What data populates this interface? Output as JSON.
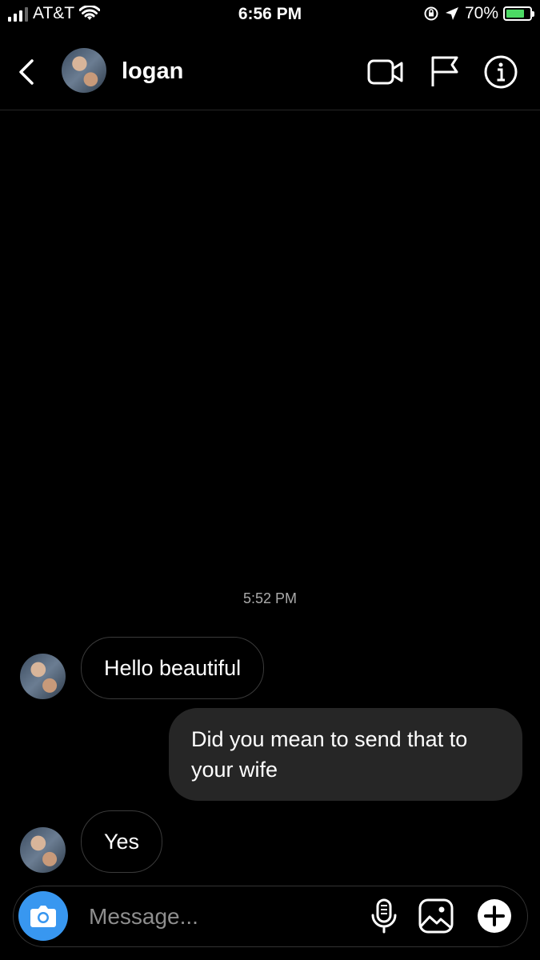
{
  "status_bar": {
    "carrier": "AT&T",
    "time": "6:56 PM",
    "battery_percent": "70%",
    "battery_level": 0.7,
    "battery_color": "#4cd964"
  },
  "header": {
    "back_icon": "chevron-left-icon",
    "username": "logan",
    "video_icon": "video-camera-icon",
    "flag_icon": "flag-icon",
    "info_icon": "info-icon"
  },
  "chat": {
    "timestamp": "5:52 PM",
    "messages": [
      {
        "direction": "incoming",
        "text": "Hello beautiful"
      },
      {
        "direction": "outgoing",
        "text": "Did you mean to send that to your wife"
      },
      {
        "direction": "incoming",
        "text": "Yes"
      }
    ]
  },
  "composer": {
    "placeholder": "Message...",
    "camera_icon": "camera-icon",
    "mic_icon": "microphone-icon",
    "gallery_icon": "image-icon",
    "plus_icon": "plus-icon",
    "accent_color": "#3897f0"
  }
}
